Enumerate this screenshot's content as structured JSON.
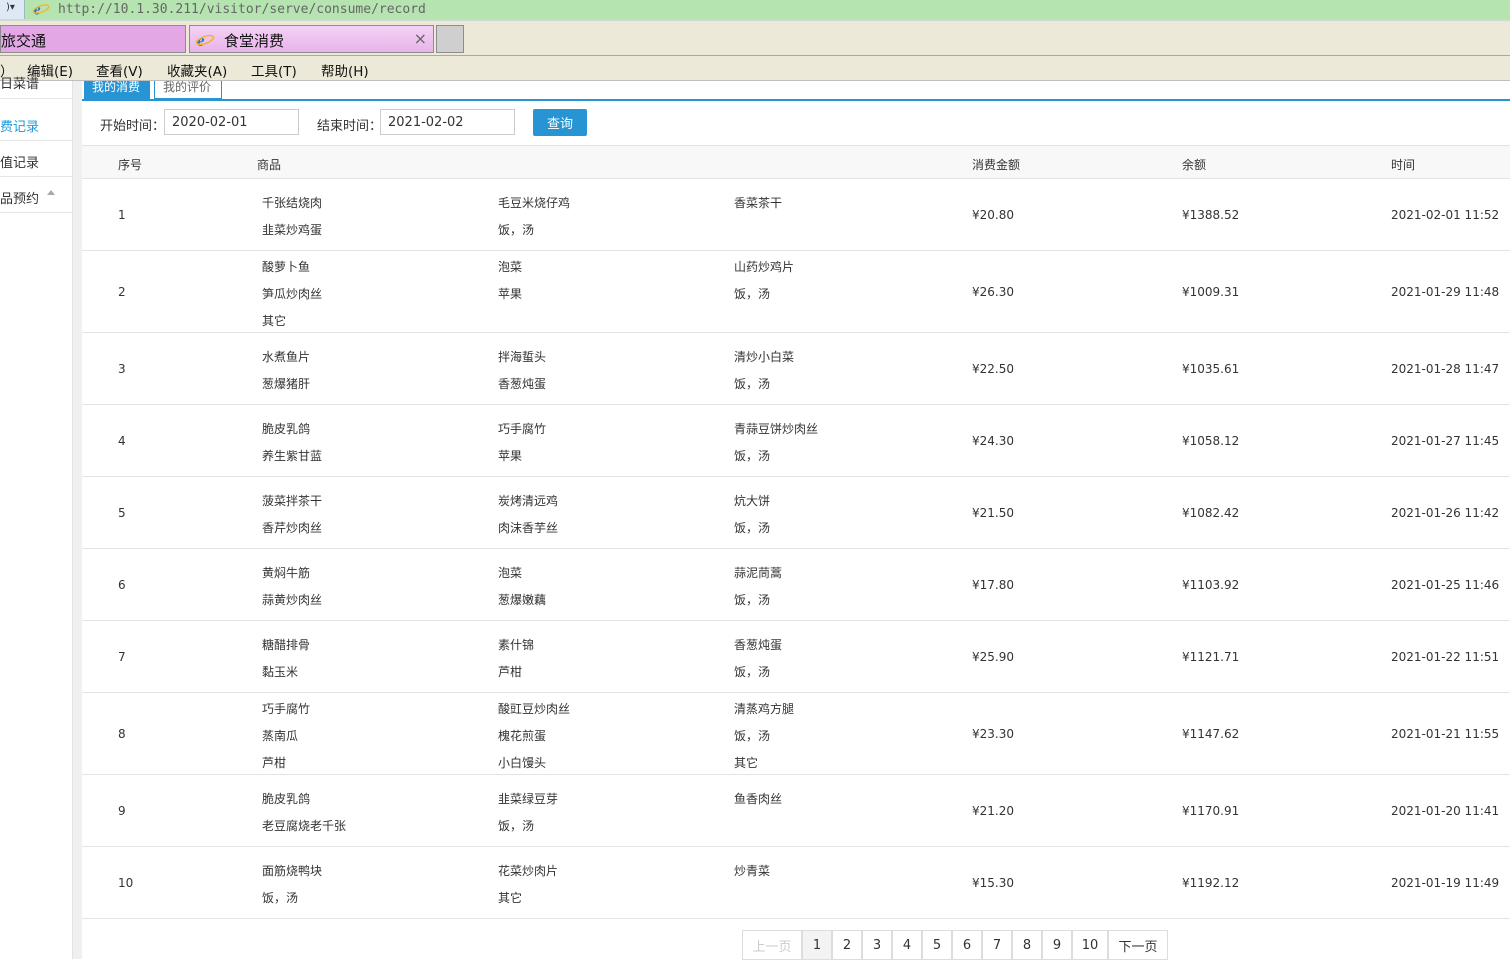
{
  "browser": {
    "nav_glyph": ")▾",
    "url": "http://10.1.30.211/visitor/serve/consume/record",
    "tabs": [
      {
        "label": "旅交通"
      },
      {
        "label": "食堂消费",
        "close": "×"
      }
    ],
    "menu": [
      "）",
      "编辑(E)",
      "查看(V)",
      "收藏夹(A)",
      "工具(T)",
      "帮助(H)"
    ]
  },
  "sidebar": {
    "items": [
      {
        "label": "日菜谱",
        "active": false
      },
      {
        "label": "费记录",
        "active": true
      },
      {
        "label": "值记录",
        "active": false
      },
      {
        "label": "品预约",
        "active": false
      }
    ]
  },
  "subtabs": [
    {
      "label": "我的消费",
      "active": true
    },
    {
      "label": "我的评价",
      "active": false
    }
  ],
  "filter": {
    "start_label": "开始时间：",
    "start_value": "2020-02-01",
    "end_label": "结束时间：",
    "end_value": "2021-02-02",
    "query_label": "查询"
  },
  "table": {
    "headers": {
      "seq": "序号",
      "goods": "商品",
      "amount": "消费金额",
      "balance": "余额",
      "time": "时间"
    },
    "rows": [
      {
        "seq": "1",
        "items": [
          [
            "千张结烧肉",
            "毛豆米烧仔鸡",
            "香菜茶干"
          ],
          [
            "韭菜炒鸡蛋",
            "饭，汤"
          ]
        ],
        "amount": "¥20.80",
        "balance": "¥1388.52",
        "time": "2021-02-01 11:52"
      },
      {
        "seq": "2",
        "items": [
          [
            "酸萝卜鱼",
            "泡菜",
            "山药炒鸡片"
          ],
          [
            "笋瓜炒肉丝",
            "苹果",
            "饭，汤"
          ],
          [
            "其它"
          ]
        ],
        "amount": "¥26.30",
        "balance": "¥1009.31",
        "time": "2021-01-29 11:48"
      },
      {
        "seq": "3",
        "items": [
          [
            "水煮鱼片",
            "拌海蜇头",
            "清炒小白菜"
          ],
          [
            "葱爆猪肝",
            "香葱炖蛋",
            "饭，汤"
          ]
        ],
        "amount": "¥22.50",
        "balance": "¥1035.61",
        "time": "2021-01-28 11:47"
      },
      {
        "seq": "4",
        "items": [
          [
            "脆皮乳鸽",
            "巧手腐竹",
            "青蒜豆饼炒肉丝"
          ],
          [
            "养生紫甘蓝",
            "苹果",
            "饭，汤"
          ]
        ],
        "amount": "¥24.30",
        "balance": "¥1058.12",
        "time": "2021-01-27 11:45"
      },
      {
        "seq": "5",
        "items": [
          [
            "菠菜拌茶干",
            "炭烤清远鸡",
            "炕大饼"
          ],
          [
            "香芹炒肉丝",
            "肉沫香芋丝",
            "饭，汤"
          ]
        ],
        "amount": "¥21.50",
        "balance": "¥1082.42",
        "time": "2021-01-26 11:42"
      },
      {
        "seq": "6",
        "items": [
          [
            "黄焖牛筋",
            "泡菜",
            "蒜泥茼蒿"
          ],
          [
            "蒜黄炒肉丝",
            "葱爆嫩藕",
            "饭，汤"
          ]
        ],
        "amount": "¥17.80",
        "balance": "¥1103.92",
        "time": "2021-01-25 11:46"
      },
      {
        "seq": "7",
        "items": [
          [
            "糖醋排骨",
            "素什锦",
            "香葱炖蛋"
          ],
          [
            "黏玉米",
            "芦柑",
            "饭，汤"
          ]
        ],
        "amount": "¥25.90",
        "balance": "¥1121.71",
        "time": "2021-01-22 11:51"
      },
      {
        "seq": "8",
        "items": [
          [
            "巧手腐竹",
            "酸豇豆炒肉丝",
            "清蒸鸡方腿"
          ],
          [
            "蒸南瓜",
            "槐花煎蛋",
            "饭，汤"
          ],
          [
            "芦柑",
            "小白馒头",
            "其它"
          ]
        ],
        "amount": "¥23.30",
        "balance": "¥1147.62",
        "time": "2021-01-21 11:55"
      },
      {
        "seq": "9",
        "items": [
          [
            "脆皮乳鸽",
            "韭菜绿豆芽",
            "鱼香肉丝"
          ],
          [
            "老豆腐烧老千张",
            "饭，汤"
          ]
        ],
        "amount": "¥21.20",
        "balance": "¥1170.91",
        "time": "2021-01-20 11:41"
      },
      {
        "seq": "10",
        "items": [
          [
            "面筋烧鸭块",
            "花菜炒肉片",
            "炒青菜"
          ],
          [
            "饭，汤",
            "其它"
          ]
        ],
        "amount": "¥15.30",
        "balance": "¥1192.12",
        "time": "2021-01-19 11:49"
      }
    ]
  },
  "pagination": {
    "prev": "上一页",
    "pages": [
      "1",
      "2",
      "3",
      "4",
      "5",
      "6",
      "7",
      "8",
      "9",
      "10"
    ],
    "current": "1",
    "next": "下一页"
  },
  "colors": {
    "accent": "#2795d3",
    "address_bar": "#b5e4b1",
    "tab_active": "#e8b3ea"
  }
}
